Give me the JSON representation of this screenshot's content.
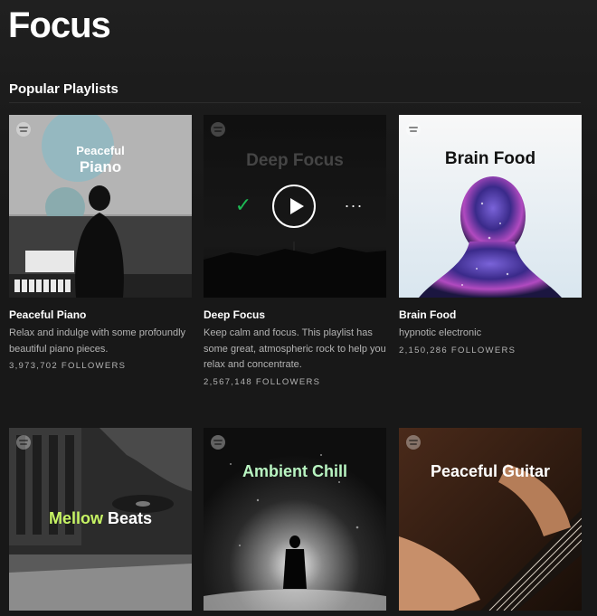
{
  "page": {
    "title": "Focus"
  },
  "section": {
    "title": "Popular Playlists"
  },
  "playlists": [
    {
      "cover_line1": "Peaceful",
      "cover_line2": "Piano",
      "name": "Peaceful Piano",
      "description": "Relax and indulge with some profoundly beautiful piano pieces.",
      "followers": "3,973,702 FOLLOWERS"
    },
    {
      "cover_title": "Deep Focus",
      "name": "Deep Focus",
      "description": "Keep calm and focus. This playlist has some great, atmospheric rock to help you relax and concentrate.",
      "followers": "2,567,148 FOLLOWERS",
      "controls": {
        "check_icon": "✓",
        "more_icon": "···"
      }
    },
    {
      "cover_title": "Brain Food",
      "name": "Brain Food",
      "description": "hypnotic electronic",
      "followers": "2,150,286 FOLLOWERS"
    },
    {
      "cover_line1": "Mellow",
      "cover_line2": "Beats",
      "accent": "#c7f464"
    },
    {
      "cover_title": "Ambient Chill",
      "accent": "#b9f5c2"
    },
    {
      "cover_title": "Peaceful Guitar"
    }
  ],
  "colors": {
    "background": "#181818",
    "text_secondary": "#b3b3b3",
    "spotify_green": "#1db954"
  }
}
